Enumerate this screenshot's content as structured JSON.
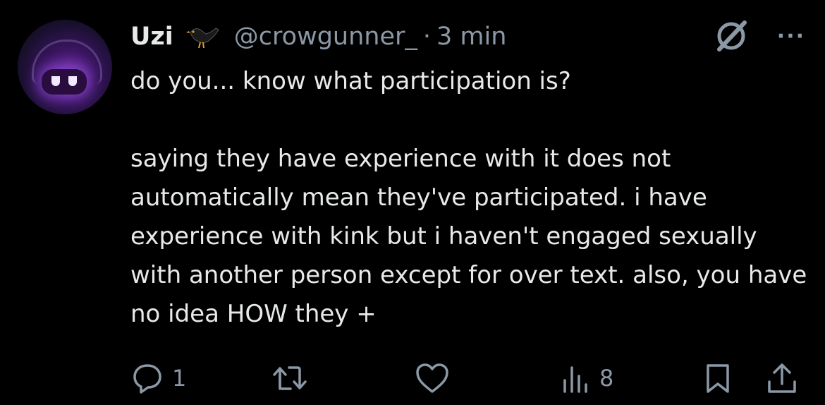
{
  "tweet": {
    "author": {
      "name": "Uzi",
      "handle": "@crowgunner_",
      "separator": "·",
      "time": "3 min"
    },
    "text": "do you... know what participation is?\n\nsaying they have experience with it does not automatically mean they've participated. i have experience with kink but i haven't engaged sexually with another person except for over text. also, you have no idea HOW they +",
    "header_icons": [
      "bird-emoji",
      "grok-icon",
      "more-icon"
    ],
    "more_label": "···",
    "actions": {
      "reply": {
        "icon": "reply-icon",
        "count": "1"
      },
      "retweet": {
        "icon": "retweet-icon",
        "count": ""
      },
      "like": {
        "icon": "heart-icon",
        "count": ""
      },
      "views": {
        "icon": "views-icon",
        "count": "8"
      },
      "bookmark": {
        "icon": "bookmark-icon"
      },
      "share": {
        "icon": "share-icon"
      }
    }
  },
  "colors": {
    "background": "#000000",
    "text": "#e7e9ea",
    "muted": "#8b98a5"
  }
}
